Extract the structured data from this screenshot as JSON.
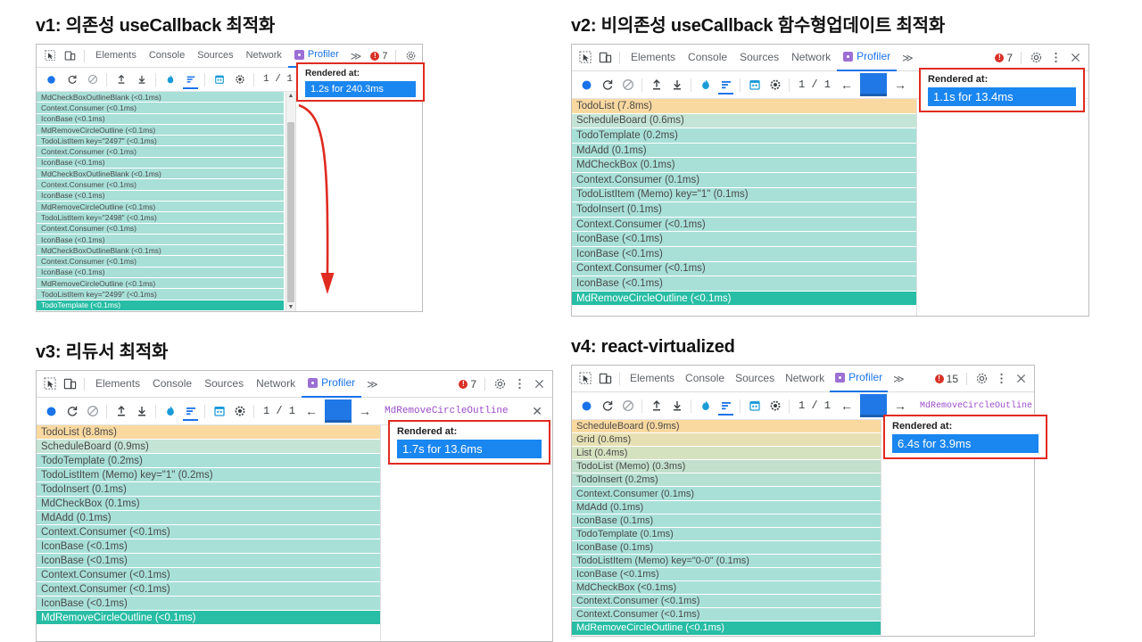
{
  "panels": [
    {
      "id": "v1",
      "title": "v1: 의존성 useCallback 최적화",
      "tabs": [
        "Elements",
        "Console",
        "Sources",
        "Network"
      ],
      "active_tab": "Profiler",
      "overflow_label": "≫",
      "error_count": "7",
      "page_count": "1 / 1",
      "commit_name": "TodoTemplate",
      "callout": {
        "label": "Rendered at:",
        "value": "1.2s for 240.3ms"
      },
      "rows": [
        {
          "label": "MdCheckBoxOutlineBlank (<0.1ms)",
          "color": "#a8e0d8"
        },
        {
          "label": "Context.Consumer (<0.1ms)",
          "color": "#a8e0d8"
        },
        {
          "label": "IconBase (<0.1ms)",
          "color": "#a8e0d8"
        },
        {
          "label": "MdRemoveCircleOutline (<0.1ms)",
          "color": "#a8e0d8"
        },
        {
          "label": "TodoListItem key=\"2497\" (<0.1ms)",
          "color": "#a8e0d8"
        },
        {
          "label": "Context.Consumer (<0.1ms)",
          "color": "#a8e0d8"
        },
        {
          "label": "IconBase (<0.1ms)",
          "color": "#a8e0d8"
        },
        {
          "label": "MdCheckBoxOutlineBlank (<0.1ms)",
          "color": "#a8e0d8"
        },
        {
          "label": "Context.Consumer (<0.1ms)",
          "color": "#a8e0d8"
        },
        {
          "label": "IconBase (<0.1ms)",
          "color": "#a8e0d8"
        },
        {
          "label": "MdRemoveCircleOutline (<0.1ms)",
          "color": "#a8e0d8"
        },
        {
          "label": "TodoListItem key=\"2498\" (<0.1ms)",
          "color": "#a8e0d8"
        },
        {
          "label": "Context.Consumer (<0.1ms)",
          "color": "#a8e0d8"
        },
        {
          "label": "IconBase (<0.1ms)",
          "color": "#a8e0d8"
        },
        {
          "label": "MdCheckBoxOutlineBlank (<0.1ms)",
          "color": "#a8e0d8"
        },
        {
          "label": "Context.Consumer (<0.1ms)",
          "color": "#a8e0d8"
        },
        {
          "label": "IconBase (<0.1ms)",
          "color": "#a8e0d8"
        },
        {
          "label": "MdRemoveCircleOutline (<0.1ms)",
          "color": "#a8e0d8"
        },
        {
          "label": "TodoListItem key=\"2499\" (<0.1ms)",
          "color": "#a8e0d8"
        },
        {
          "label": "TodoTemplate (<0.1ms)",
          "color": "#28bda5",
          "selected": true
        }
      ]
    },
    {
      "id": "v2",
      "title": "v2: 비의존성 useCallback 함수형업데이트 최적화",
      "tabs": [
        "Elements",
        "Console",
        "Sources",
        "Network"
      ],
      "active_tab": "Profiler",
      "overflow_label": "≫",
      "error_count": "7",
      "page_count": "1 / 1",
      "commit_name": "MdRemoveCircleOutline",
      "callout": {
        "label": "Rendered at:",
        "value": "1.1s for 13.4ms"
      },
      "rows": [
        {
          "label": "TodoList (7.8ms)",
          "color": "#fad9a0"
        },
        {
          "label": "ScheduleBoard (0.6ms)",
          "color": "#c4e4d6"
        },
        {
          "label": "TodoTemplate (0.2ms)",
          "color": "#a8e0d8"
        },
        {
          "label": "MdAdd (0.1ms)",
          "color": "#a8e0d8"
        },
        {
          "label": "MdCheckBox (0.1ms)",
          "color": "#a8e0d8"
        },
        {
          "label": "Context.Consumer (0.1ms)",
          "color": "#a8e0d8"
        },
        {
          "label": "TodoListItem (Memo) key=\"1\" (0.1ms)",
          "color": "#a8e0d8"
        },
        {
          "label": "TodoInsert (0.1ms)",
          "color": "#a8e0d8"
        },
        {
          "label": "Context.Consumer (<0.1ms)",
          "color": "#a8e0d8"
        },
        {
          "label": "IconBase (<0.1ms)",
          "color": "#a8e0d8"
        },
        {
          "label": "IconBase (<0.1ms)",
          "color": "#a8e0d8"
        },
        {
          "label": "Context.Consumer (<0.1ms)",
          "color": "#a8e0d8"
        },
        {
          "label": "IconBase (<0.1ms)",
          "color": "#a8e0d8"
        },
        {
          "label": "MdRemoveCircleOutline (<0.1ms)",
          "color": "#28bda5",
          "selected": true
        }
      ]
    },
    {
      "id": "v3",
      "title": "v3: 리듀서 최적화",
      "tabs": [
        "Elements",
        "Console",
        "Sources",
        "Network"
      ],
      "active_tab": "Profiler",
      "overflow_label": "≫",
      "error_count": "7",
      "page_count": "1 / 1",
      "commit_name": "MdRemoveCircleOutline",
      "callout": {
        "label": "Rendered at:",
        "value": "1.7s for 13.6ms"
      },
      "rows": [
        {
          "label": "TodoList (8.8ms)",
          "color": "#fad9a0"
        },
        {
          "label": "ScheduleBoard (0.9ms)",
          "color": "#c4e4d6"
        },
        {
          "label": "TodoTemplate (0.2ms)",
          "color": "#a8e0d8"
        },
        {
          "label": "TodoListItem (Memo) key=\"1\" (0.2ms)",
          "color": "#a8e0d8"
        },
        {
          "label": "TodoInsert (0.1ms)",
          "color": "#a8e0d8"
        },
        {
          "label": "MdCheckBox (0.1ms)",
          "color": "#a8e0d8"
        },
        {
          "label": "MdAdd (0.1ms)",
          "color": "#a8e0d8"
        },
        {
          "label": "Context.Consumer (<0.1ms)",
          "color": "#a8e0d8"
        },
        {
          "label": "IconBase (<0.1ms)",
          "color": "#a8e0d8"
        },
        {
          "label": "IconBase (<0.1ms)",
          "color": "#a8e0d8"
        },
        {
          "label": "Context.Consumer (<0.1ms)",
          "color": "#a8e0d8"
        },
        {
          "label": "Context.Consumer (<0.1ms)",
          "color": "#a8e0d8"
        },
        {
          "label": "IconBase (<0.1ms)",
          "color": "#a8e0d8"
        },
        {
          "label": "MdRemoveCircleOutline (<0.1ms)",
          "color": "#28bda5",
          "selected": true
        }
      ]
    },
    {
      "id": "v4",
      "title": "v4: react-virtualized",
      "tabs": [
        "Elements",
        "Console",
        "Sources",
        "Network"
      ],
      "active_tab": "Profiler",
      "overflow_label": "≫",
      "error_count": "15",
      "page_count": "1 / 1",
      "commit_name": "MdRemoveCircleOutline",
      "callout": {
        "label": "Rendered at:",
        "value": "6.4s for 3.9ms"
      },
      "rows": [
        {
          "label": "ScheduleBoard (0.9ms)",
          "color": "#fad9a0"
        },
        {
          "label": "Grid (0.6ms)",
          "color": "#e6e0b4"
        },
        {
          "label": "List (0.4ms)",
          "color": "#d5e2c0"
        },
        {
          "label": "TodoList (Memo) (0.3ms)",
          "color": "#c2e0cb"
        },
        {
          "label": "TodoInsert (0.2ms)",
          "color": "#b5e0d2"
        },
        {
          "label": "Context.Consumer (0.1ms)",
          "color": "#a8e0d8"
        },
        {
          "label": "MdAdd (0.1ms)",
          "color": "#a8e0d8"
        },
        {
          "label": "IconBase (0.1ms)",
          "color": "#a8e0d8"
        },
        {
          "label": "TodoTemplate (0.1ms)",
          "color": "#a8e0d8"
        },
        {
          "label": "IconBase (0.1ms)",
          "color": "#a8e0d8"
        },
        {
          "label": "TodoListItem (Memo) key=\"0-0\" (0.1ms)",
          "color": "#a8e0d8"
        },
        {
          "label": "IconBase (<0.1ms)",
          "color": "#a8e0d8"
        },
        {
          "label": "MdCheckBox (<0.1ms)",
          "color": "#a8e0d8"
        },
        {
          "label": "Context.Consumer (<0.1ms)",
          "color": "#a8e0d8"
        },
        {
          "label": "Context.Consumer (<0.1ms)",
          "color": "#a8e0d8"
        },
        {
          "label": "MdRemoveCircleOutline (<0.1ms)",
          "color": "#28bda5",
          "selected": true
        }
      ]
    }
  ],
  "icons": {
    "inspect": "inspect-element-icon",
    "device": "device-toolbar-icon",
    "record": "record-icon",
    "reload": "reload-and-record-icon",
    "clear": "clear-icon",
    "upload": "load-profile-icon",
    "download": "save-profile-icon",
    "flame": "flamegraph-icon",
    "ranked": "ranked-chart-icon",
    "timeline": "timeline-icon",
    "settings": "settings-icon",
    "gear": "gear-icon",
    "more": "more-options-icon",
    "close": "close-icon",
    "prev": "←",
    "next": "→"
  },
  "colors": {
    "accent": "#1a73e8",
    "error": "#d93025",
    "callout_border": "#e02b20",
    "selected_row": "#28bda5",
    "hot_row": "#fad9a0",
    "cool_row": "#a8e0d8",
    "commit_name": "#9b4dca"
  }
}
